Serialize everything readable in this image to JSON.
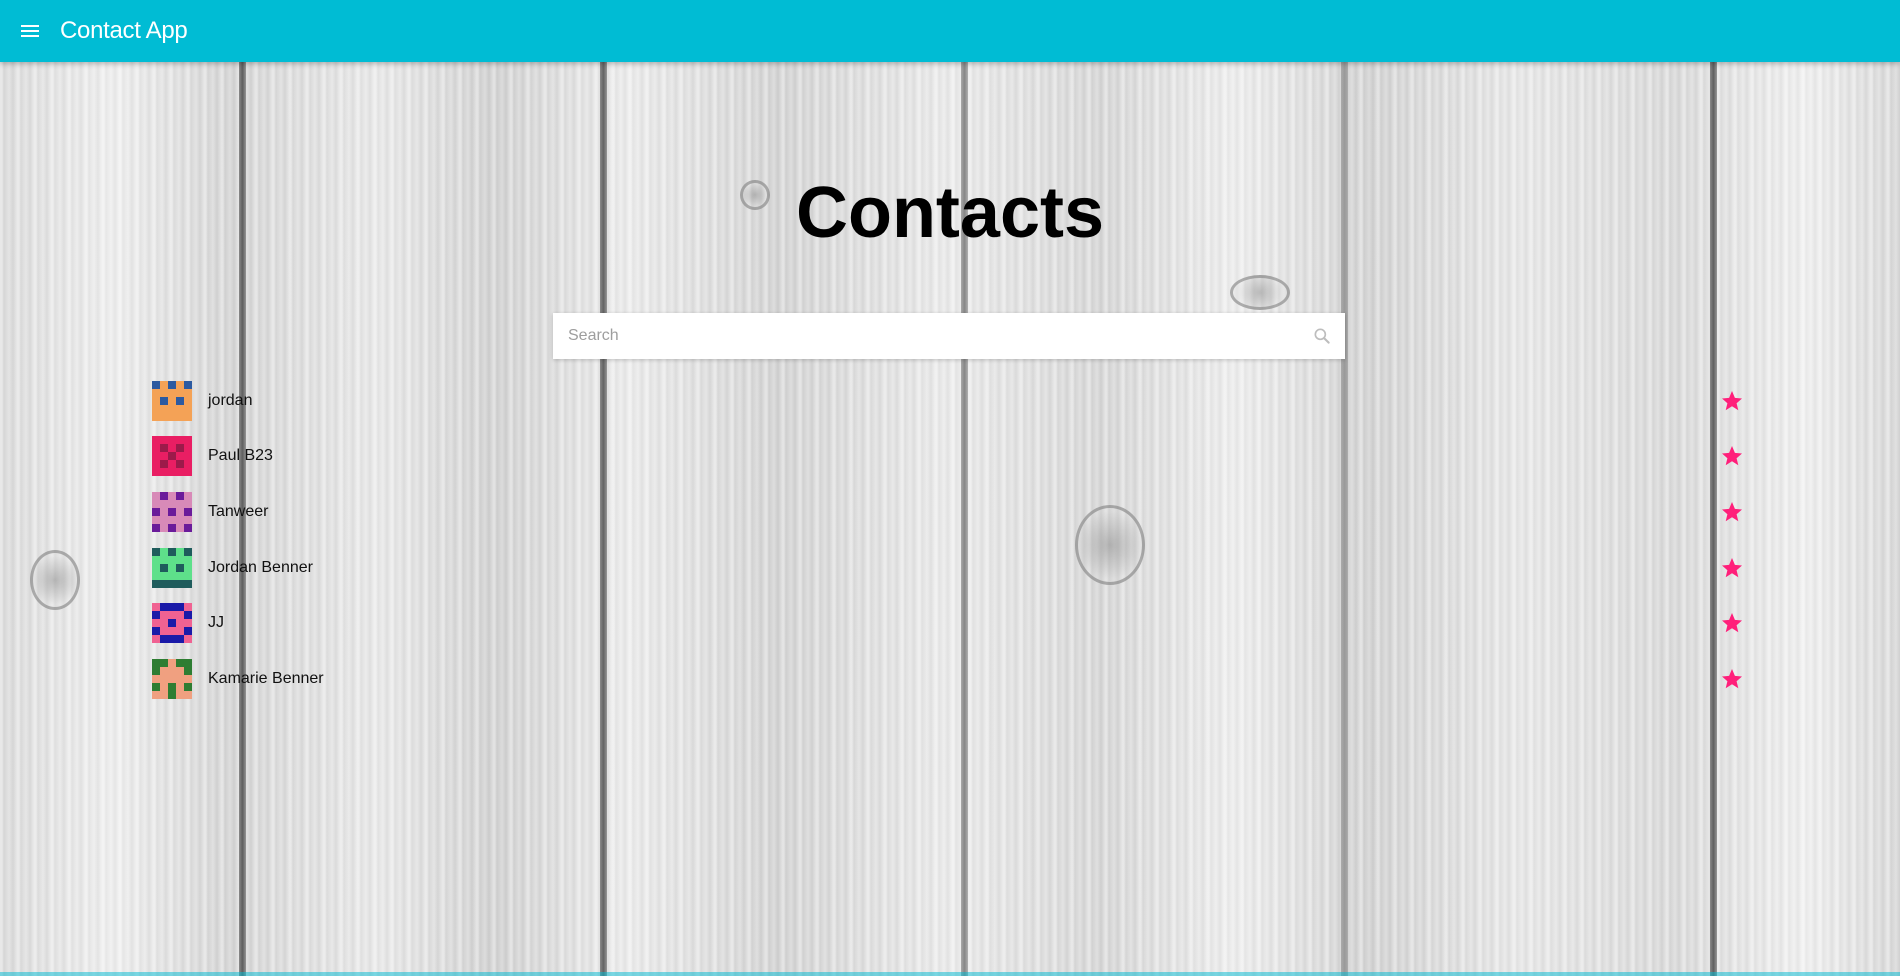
{
  "appbar": {
    "title": "Contact App",
    "menu_icon": "menu-icon"
  },
  "main": {
    "heading": "Contacts",
    "search": {
      "placeholder": "Search",
      "value": "",
      "icon": "search-icon"
    }
  },
  "contacts": [
    {
      "name": "jordan",
      "avatar_colors": [
        "#f4a256",
        "#2c5aa0"
      ],
      "favorite": true
    },
    {
      "name": "Paul B23",
      "avatar_colors": [
        "#e91e63",
        "#9c1a4a"
      ],
      "favorite": true
    },
    {
      "name": "Tanweer",
      "avatar_colors": [
        "#d88ab8",
        "#6a1b9a"
      ],
      "favorite": true
    },
    {
      "name": "Jordan Benner",
      "avatar_colors": [
        "#5ee08a",
        "#1f5c5c"
      ],
      "favorite": true
    },
    {
      "name": "JJ",
      "avatar_colors": [
        "#f06292",
        "#1a1aa8"
      ],
      "favorite": true
    },
    {
      "name": "Kamarie Benner",
      "avatar_colors": [
        "#f0a080",
        "#2e7d32"
      ],
      "favorite": true
    }
  ],
  "colors": {
    "accent": "#00bcd4",
    "star": "#ff1f7a"
  }
}
